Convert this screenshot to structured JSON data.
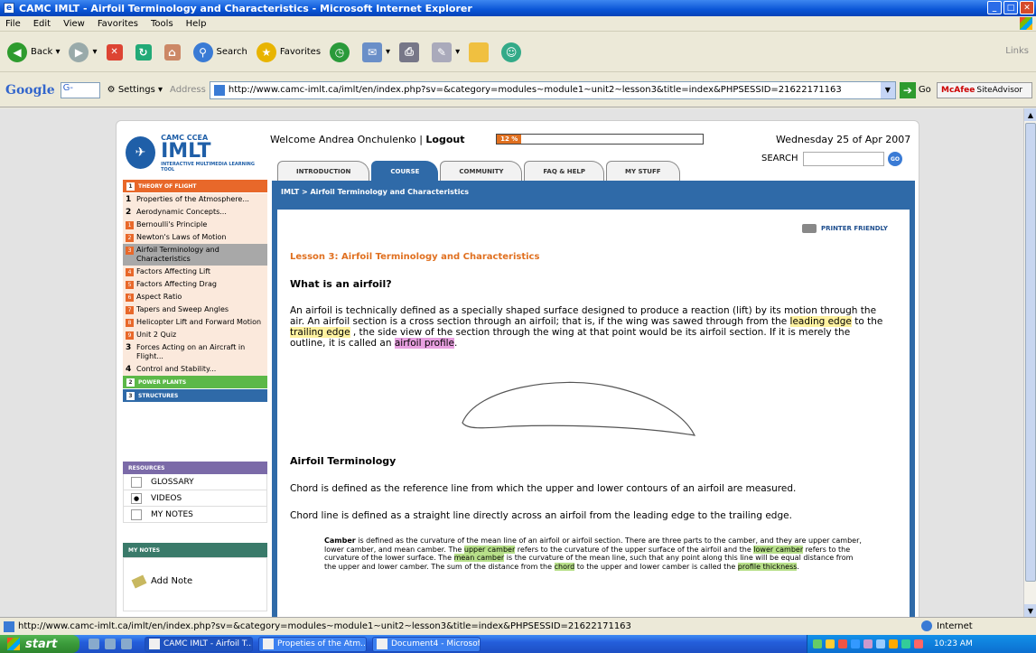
{
  "window": {
    "title": "CAMC IMLT - Airfoil Terminology and Characteristics - Microsoft Internet Explorer"
  },
  "menu": [
    "File",
    "Edit",
    "View",
    "Favorites",
    "Tools",
    "Help"
  ],
  "toolbar": {
    "back": "Back",
    "search": "Search",
    "favorites": "Favorites",
    "links": "Links"
  },
  "addressbar": {
    "google": "Google",
    "google_field": "G-",
    "settings": "Settings",
    "address_label": "Address",
    "url": "http://www.camc-imlt.ca/imlt/en/index.php?sv=&category=modules~module1~unit2~lesson3&title=index&PHPSESSID=21622171163",
    "go": "Go",
    "mcafee": "SiteAdvisor",
    "mcafee_brand": "McAfee"
  },
  "site": {
    "logo_small": "CAMC CCEA",
    "logo_big": "IMLT",
    "logo_tag": "INTERACTIVE MULTIMEDIA LEARNING TOOL",
    "welcome": "Welcome Andrea Onchulenko",
    "logout": "Logout",
    "progress_label": "12 %",
    "progress_fraction": 0.12,
    "date": "Wednesday 25 of Apr 2007",
    "search_label": "SEARCH",
    "search_go": "GO"
  },
  "tabs": [
    {
      "label": "INTRODUCTION",
      "active": false
    },
    {
      "label": "COURSE",
      "active": true
    },
    {
      "label": "COMMUNITY",
      "active": false
    },
    {
      "label": "FAQ & HELP",
      "active": false
    },
    {
      "label": "MY STUFF",
      "active": false
    }
  ],
  "sidebar": {
    "section1": "THEORY OF FLIGHT",
    "items": [
      {
        "num": "1",
        "label": "Properties of the Atmosphere..."
      },
      {
        "num": "2",
        "label": "Aerodynamic Concepts..."
      },
      {
        "badge": "1",
        "label": "Bernoulli's Principle"
      },
      {
        "badge": "2",
        "label": "Newton's Laws of Motion"
      },
      {
        "badge": "3",
        "label": "Airfoil Terminology and Characteristics",
        "selected": true
      },
      {
        "badge": "4",
        "label": "Factors Affecting Lift"
      },
      {
        "badge": "5",
        "label": "Factors Affecting Drag"
      },
      {
        "badge": "6",
        "label": "Aspect Ratio"
      },
      {
        "badge": "7",
        "label": "Tapers and Sweep Angles"
      },
      {
        "badge": "8",
        "label": "Helicopter Lift and Forward Motion"
      },
      {
        "badge": "9",
        "label": "Unit 2 Quiz"
      },
      {
        "num": "3",
        "label": "Forces Acting on an Aircraft in Flight..."
      },
      {
        "num": "4",
        "label": "Control and Stability..."
      }
    ],
    "section2": "POWER PLANTS",
    "section3": "STRUCTURES",
    "resources_head": "RESOURCES",
    "resources": [
      "GLOSSARY",
      "VIDEOS",
      "MY NOTES"
    ],
    "notes_head": "MY NOTES",
    "add_note": "Add Note"
  },
  "content": {
    "breadcrumb": "IMLT > Airfoil Terminology and Characteristics",
    "printer": "PRINTER FRIENDLY",
    "lesson_title": "Lesson 3: Airfoil Terminology and Characteristics",
    "h_what": "What is an airfoil?",
    "para1_a": "An airfoil is technically defined as a specially shaped surface designed to produce a reaction (lift) by its motion through the air. An airfoil section is a cross section through an airfoil; that is, if the wing was sawed through from the ",
    "para1_leading": "leading edge",
    "para1_b": " to the ",
    "para1_trailing": "trailing edge",
    "para1_c": " , the side view of the section through the wing at that point would be its airfoil section. If it is merely the outline, it is called an ",
    "para1_profile": "airfoil profile",
    "para1_d": ".",
    "h_term": "Airfoil Terminology",
    "chord1": "Chord is defined as the reference line from which the upper and lower contours of an airfoil are measured.",
    "chord2": "Chord line is defined as a straight line directly across an airfoil from the leading edge to the trailing edge.",
    "camber_bold": "Camber",
    "camber_a": " is defined as the curvature of the mean line of an airfoil or airfoil section. There are three parts to the camber, and they are upper camber, lower camber, and mean camber. The ",
    "camber_upper": "upper camber",
    "camber_b": " refers to the curvature of the upper surface of the airfoil and the ",
    "camber_lower": "lower camber",
    "camber_c": " refers to the curvature of the lower surface. The ",
    "camber_mean": "mean camber",
    "camber_d": " is the curvature of the mean line, such that any point along this line will be equal distance from the upper and lower camber. The sum of the distance from the ",
    "camber_chord": "chord",
    "camber_e": " to the upper and lower camber is called the ",
    "camber_thickness": "profile thickness",
    "camber_f": "."
  },
  "statusbar": {
    "url": "http://www.camc-imlt.ca/imlt/en/index.php?sv=&category=modules~module1~unit2~lesson3&title=index&PHPSESSID=21622171163",
    "zone": "Internet"
  },
  "taskbar": {
    "start": "start",
    "tasks": [
      "CAMC IMLT - Airfoil T...",
      "Propeties of the Atm...",
      "Document4 - Microsof..."
    ],
    "clock": "10:23 AM"
  }
}
